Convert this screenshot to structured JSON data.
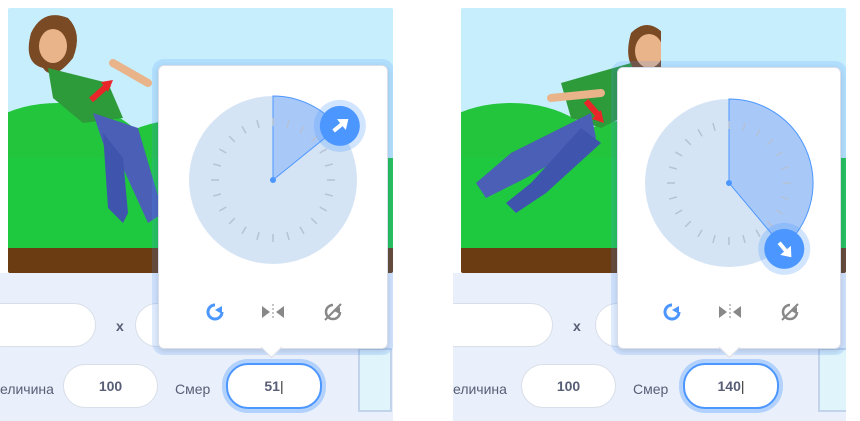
{
  "panels": [
    {
      "size_label": "еличина",
      "size_value": "100",
      "direction_label": "Смер",
      "direction_value": "51",
      "x_label": "x",
      "direction_degrees": 51
    },
    {
      "size_label": "еличина",
      "size_value": "100",
      "direction_label": "Смер",
      "direction_value": "140",
      "x_label": "x",
      "direction_degrees": 140
    }
  ],
  "modes": [
    "all-around-rotation-icon",
    "left-right-flip-icon",
    "dont-rotate-icon"
  ],
  "colors": {
    "accent": "#4c97ff",
    "dial": "#d5e4f5",
    "wedge": "#a8c8f8",
    "grass": "#1fc93f",
    "dirt": "#6b3b12"
  }
}
